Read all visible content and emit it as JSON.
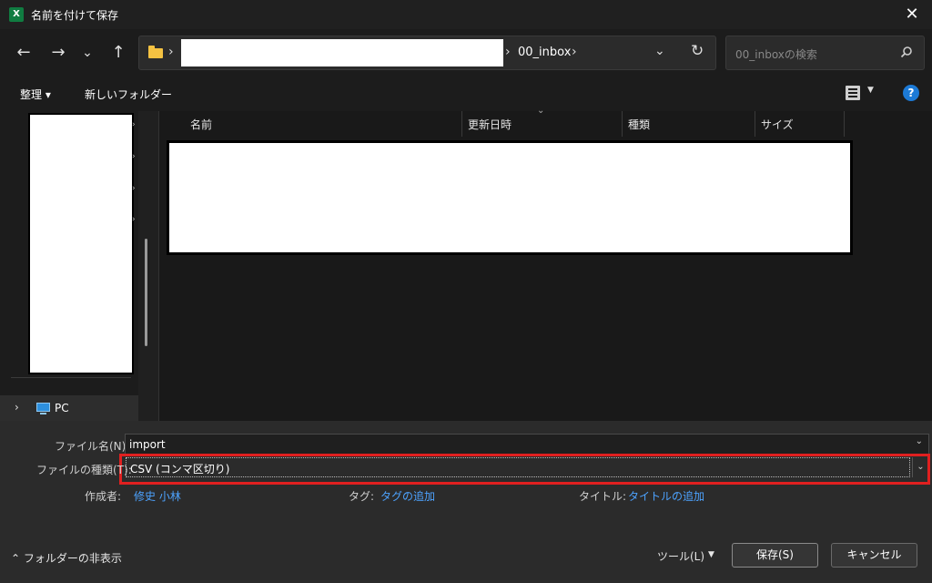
{
  "window": {
    "title": "名前を付けて保存",
    "app_icon_letter": "X",
    "close_glyph": "✕"
  },
  "nav": {
    "back": "←",
    "forward": "→",
    "recent": "⌄",
    "up": "↑",
    "address": {
      "crumb": "00_inbox",
      "separator": "›",
      "dropdown": "⌄",
      "refresh": "↻"
    },
    "search_placeholder": "00_inboxの検索"
  },
  "commandbar": {
    "organize": "整理 ▾",
    "new_folder": "新しいフォルダー"
  },
  "navpane": {
    "pc_label": "PC",
    "pc_chevron": "›"
  },
  "filelist": {
    "columns": [
      "名前",
      "更新日時",
      "種類",
      "サイズ"
    ]
  },
  "bottom": {
    "filename_label": "ファイル名(N):",
    "filename_value": "import",
    "filetype_label": "ファイルの種類(T):",
    "filetype_value": "CSV (コンマ区切り)",
    "author_label": "作成者:",
    "author_value": "修史 小林",
    "tags_label": "タグ:",
    "tags_value": "タグの追加",
    "title_label": "タイトル:",
    "title_value": "タイトルの追加",
    "hide_folders": "⌃ フォルダーの非表示",
    "tools": "ツール(L)",
    "save": "保存(S)",
    "cancel": "キャンセル"
  },
  "colors": {
    "accent": "#4da3ff",
    "highlight": "#e02020",
    "excel_green": "#107c41"
  }
}
